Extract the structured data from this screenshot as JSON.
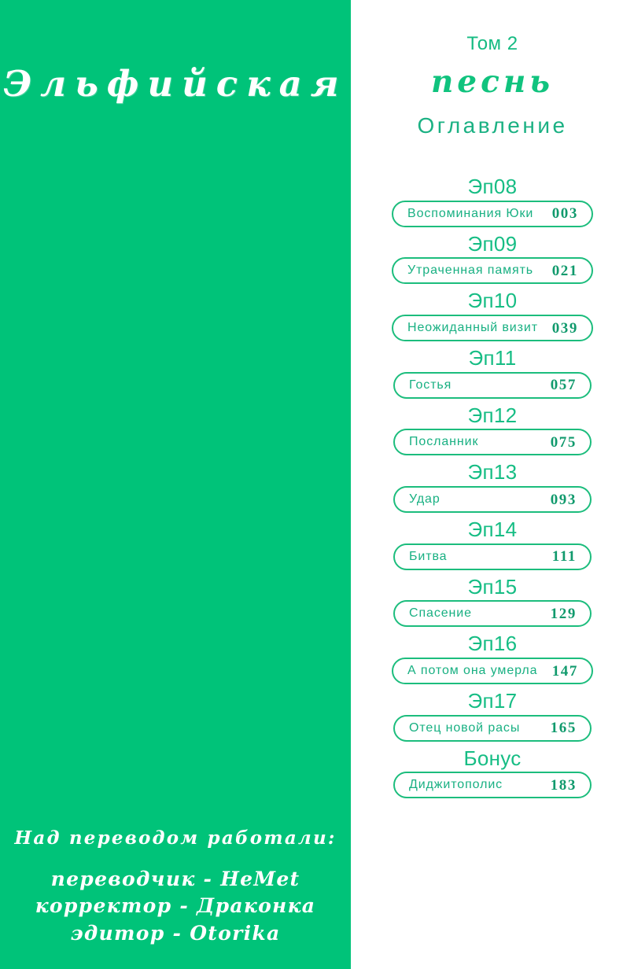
{
  "colors": {
    "green_panel": "#00c379",
    "accent": "#16bd84",
    "pill_border": "#1cbd7d",
    "page_number": "#119a6d",
    "white": "#ffffff"
  },
  "left_panel": {
    "series_title": "Эльфийская",
    "credits": {
      "heading": "Над переводом работали:",
      "lines": [
        "переводчик  -  HeMet",
        "корректор  -  Драконка",
        "эдитор  -  Otorika"
      ]
    }
  },
  "right_panel": {
    "volume_label": "Том 2",
    "song_word": "песнь",
    "toc_word": "Оглавление",
    "entries": [
      {
        "episode": "Эп08",
        "title": "Воспоминания Юки",
        "page": "003",
        "wide": true
      },
      {
        "episode": "Эп09",
        "title": "Утраченная память",
        "page": "021",
        "wide": true
      },
      {
        "episode": "Эп10",
        "title": "Неожиданный визит",
        "page": "039",
        "wide": true
      },
      {
        "episode": "Эп11",
        "title": "Гостья",
        "page": "057",
        "wide": false
      },
      {
        "episode": "Эп12",
        "title": "Посланник",
        "page": "075",
        "wide": false
      },
      {
        "episode": "Эп13",
        "title": "Удар",
        "page": "093",
        "wide": false
      },
      {
        "episode": "Эп14",
        "title": "Битва",
        "page": "111",
        "wide": false
      },
      {
        "episode": "Эп15",
        "title": "Спасение",
        "page": "129",
        "wide": false
      },
      {
        "episode": "Эп16",
        "title": "А потом она умерла",
        "page": "147",
        "wide": true
      },
      {
        "episode": "Эп17",
        "title": "Отец новой расы",
        "page": "165",
        "wide": false
      },
      {
        "episode": "Бонус",
        "title": "Диджитополис",
        "page": "183",
        "wide": false
      }
    ]
  }
}
